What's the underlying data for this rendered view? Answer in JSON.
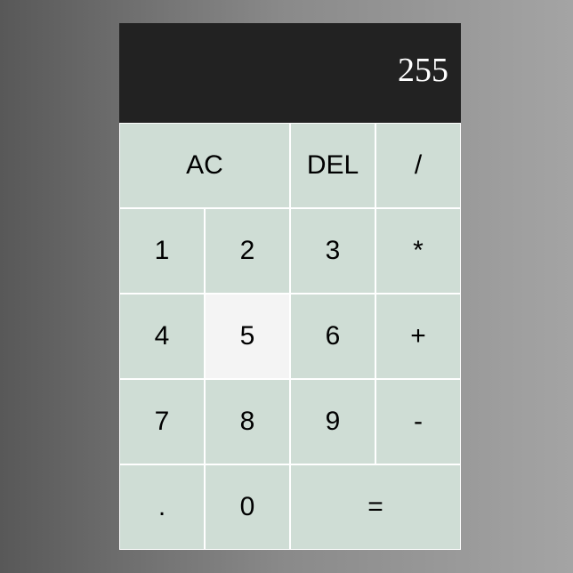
{
  "display": {
    "value": "255"
  },
  "keys": {
    "clear": "AC",
    "delete": "DEL",
    "divide": "/",
    "one": "1",
    "two": "2",
    "three": "3",
    "multiply": "*",
    "four": "4",
    "five": "5",
    "six": "6",
    "plus": "+",
    "seven": "7",
    "eight": "8",
    "nine": "9",
    "minus": "-",
    "decimal": ".",
    "zero": "0",
    "equals": "="
  },
  "colors": {
    "background_left": "#585858",
    "background_right": "#a4a4a4",
    "display_bg": "#222222",
    "display_text": "#ffffff",
    "key_bg": "#cfddd5",
    "key_active_bg": "#f4f4f4",
    "key_border": "#ffffff"
  },
  "state": {
    "hovered_key": "5"
  }
}
